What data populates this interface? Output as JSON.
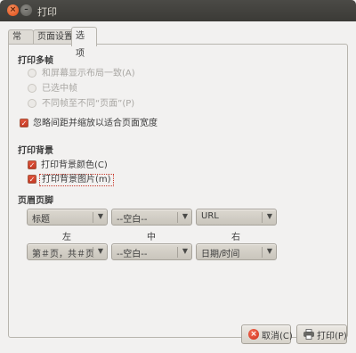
{
  "window": {
    "title": "打印"
  },
  "tabs": [
    {
      "label": "常规"
    },
    {
      "label": "页面设置"
    },
    {
      "label": "选项"
    }
  ],
  "multi_frame": {
    "title": "打印多帧",
    "options": [
      {
        "label": "和屏幕显示布局一致(A)"
      },
      {
        "label": "已选中帧"
      },
      {
        "label": "不同帧至不同“页面”(P)"
      }
    ],
    "shrink_checkbox": {
      "label": "忽略间距并缩放以适合页面宽度",
      "checked": true
    }
  },
  "background": {
    "title": "打印背景",
    "colors_checkbox": {
      "label": "打印背景颜色(C)",
      "checked": true
    },
    "images_checkbox": {
      "label": "打印背景图片(m)",
      "checked": true
    }
  },
  "header_footer": {
    "title": "页眉页脚",
    "header": {
      "left": "标题",
      "center": "--空白--",
      "right": "URL"
    },
    "columns": {
      "left": "左",
      "center": "中",
      "right": "右"
    },
    "footer": {
      "left": "第＃页，共＃页",
      "center": "--空白--",
      "right": "日期/时间"
    }
  },
  "buttons": {
    "cancel": "取消(C)",
    "print": "打印(P)"
  },
  "icons": {
    "close": "close-icon",
    "minimize": "minimize-icon",
    "dropdown": "chevron-down-icon",
    "cancel": "cancel-icon",
    "print": "printer-icon"
  },
  "colors": {
    "accent": "#d4432c",
    "titlebar": "#3c3b37",
    "background": "#f2f1f0"
  }
}
